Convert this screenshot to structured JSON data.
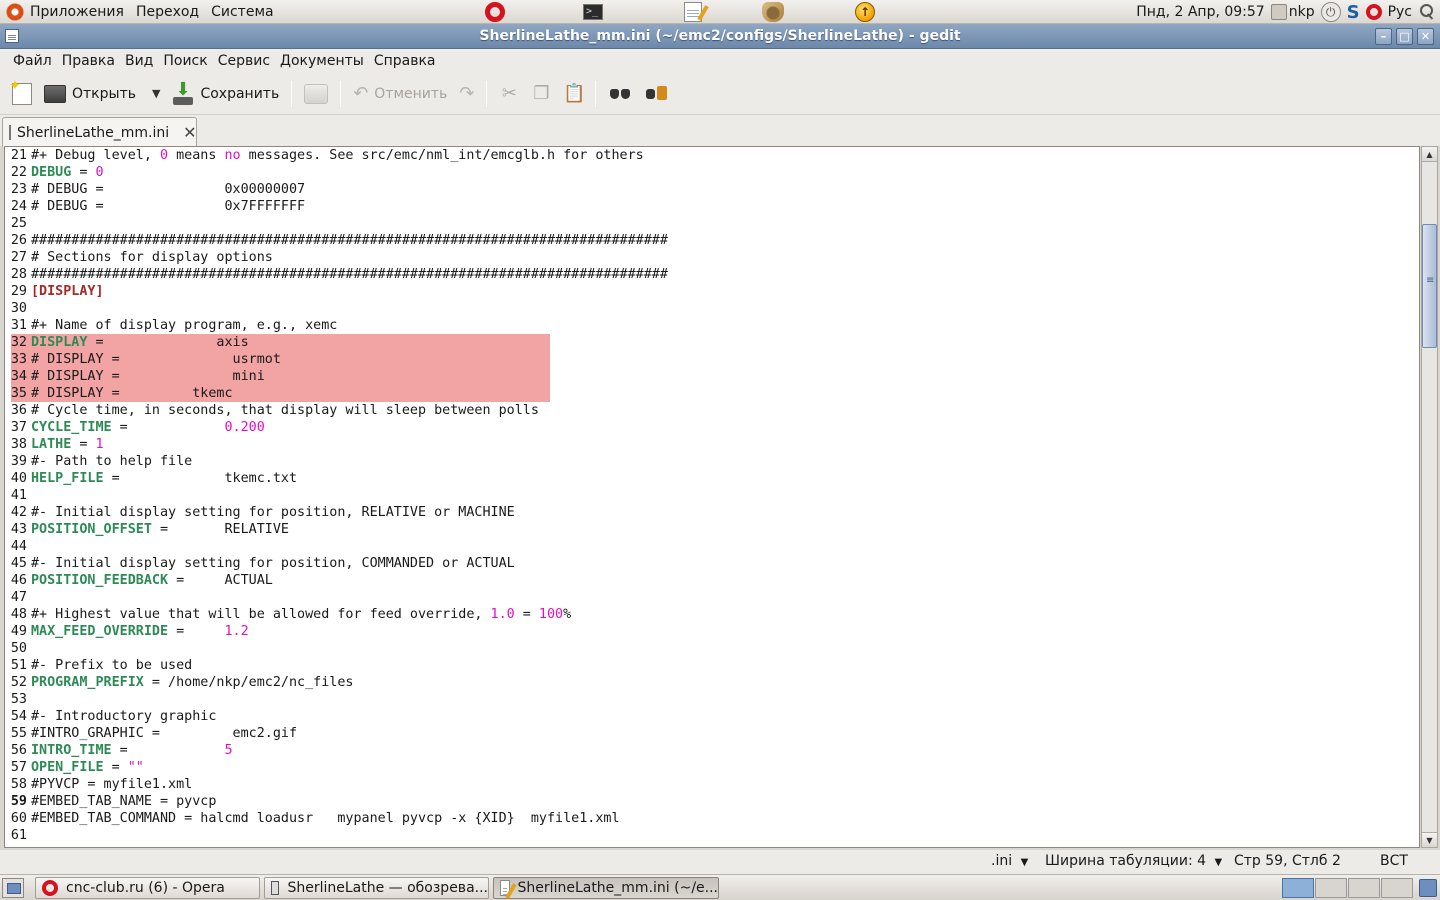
{
  "top_panel": {
    "menus": [
      "Приложения",
      "Переход",
      "Система"
    ],
    "clock": "Пнд,  2 Апр, 09:57",
    "user": "nkp",
    "keyboard_layout": "Рус"
  },
  "window": {
    "title": "SherlineLathe_mm.ini (~/emc2/configs/SherlineLathe) - gedit"
  },
  "menubar": [
    "Файл",
    "Правка",
    "Вид",
    "Поиск",
    "Сервис",
    "Документы",
    "Справка"
  ],
  "toolbar": {
    "open_label": "Открыть",
    "save_label": "Сохранить",
    "undo_label": "Отменить"
  },
  "tab": {
    "label": "SherlineLathe_mm.ini"
  },
  "editor": {
    "current_line": 59,
    "highlight_color": "#f2a3a3",
    "lines": [
      {
        "n": "21",
        "parts": [
          {
            "t": "#+ Debug level, ",
            "c": "txt"
          },
          {
            "t": "0",
            "c": "n"
          },
          {
            "t": " means ",
            "c": "txt"
          },
          {
            "t": "no",
            "c": "n"
          },
          {
            "t": " messages. See src/emc/nml_int/emcglb.h for others",
            "c": "txt"
          }
        ]
      },
      {
        "n": "22",
        "parts": [
          {
            "t": "DEBUG",
            "c": "k"
          },
          {
            "t": " = ",
            "c": "txt"
          },
          {
            "t": "0",
            "c": "n"
          }
        ]
      },
      {
        "n": "23",
        "parts": [
          {
            "t": "# DEBUG =               0x00000007",
            "c": "txt"
          }
        ]
      },
      {
        "n": "24",
        "parts": [
          {
            "t": "# DEBUG =               0x7FFFFFFF",
            "c": "txt"
          }
        ]
      },
      {
        "n": "25",
        "parts": []
      },
      {
        "n": "26",
        "parts": [
          {
            "t": "###############################################################################",
            "c": "txt"
          }
        ]
      },
      {
        "n": "27",
        "parts": [
          {
            "t": "# Sections for display options",
            "c": "txt"
          }
        ]
      },
      {
        "n": "28",
        "parts": [
          {
            "t": "###############################################################################",
            "c": "txt"
          }
        ]
      },
      {
        "n": "29",
        "parts": [
          {
            "t": "[DISPLAY]",
            "c": "sec"
          }
        ]
      },
      {
        "n": "30",
        "parts": []
      },
      {
        "n": "31",
        "parts": [
          {
            "t": "#+ Name of display program, e.g., xemc",
            "c": "txt"
          }
        ]
      },
      {
        "n": "32",
        "parts": [
          {
            "t": "DISPLAY",
            "c": "k"
          },
          {
            "t": " =              axis",
            "c": "txt"
          }
        ]
      },
      {
        "n": "33",
        "parts": [
          {
            "t": "# DISPLAY =              usrmot",
            "c": "txt"
          }
        ]
      },
      {
        "n": "34",
        "parts": [
          {
            "t": "# DISPLAY =              mini",
            "c": "txt"
          }
        ]
      },
      {
        "n": "35",
        "parts": [
          {
            "t": "# DISPLAY =         tkemc",
            "c": "txt"
          }
        ]
      },
      {
        "n": "36",
        "parts": [
          {
            "t": "# Cycle time, in seconds, that display will sleep between polls",
            "c": "txt"
          }
        ]
      },
      {
        "n": "37",
        "parts": [
          {
            "t": "CYCLE_TIME",
            "c": "k"
          },
          {
            "t": " =            ",
            "c": "txt"
          },
          {
            "t": "0.200",
            "c": "n"
          }
        ]
      },
      {
        "n": "38",
        "parts": [
          {
            "t": "LATHE",
            "c": "k"
          },
          {
            "t": " = ",
            "c": "txt"
          },
          {
            "t": "1",
            "c": "n"
          }
        ]
      },
      {
        "n": "39",
        "parts": [
          {
            "t": "#- Path to help file",
            "c": "txt"
          }
        ]
      },
      {
        "n": "40",
        "parts": [
          {
            "t": "HELP_FILE",
            "c": "k"
          },
          {
            "t": " =             tkemc.txt",
            "c": "txt"
          }
        ]
      },
      {
        "n": "41",
        "parts": []
      },
      {
        "n": "42",
        "parts": [
          {
            "t": "#- Initial display setting for position, RELATIVE or MACHINE",
            "c": "txt"
          }
        ]
      },
      {
        "n": "43",
        "parts": [
          {
            "t": "POSITION_OFFSET",
            "c": "k"
          },
          {
            "t": " =       RELATIVE",
            "c": "txt"
          }
        ]
      },
      {
        "n": "44",
        "parts": []
      },
      {
        "n": "45",
        "parts": [
          {
            "t": "#- Initial display setting for position, COMMANDED or ACTUAL",
            "c": "txt"
          }
        ]
      },
      {
        "n": "46",
        "parts": [
          {
            "t": "POSITION_FEEDBACK",
            "c": "k"
          },
          {
            "t": " =     ACTUAL",
            "c": "txt"
          }
        ]
      },
      {
        "n": "47",
        "parts": []
      },
      {
        "n": "48",
        "parts": [
          {
            "t": "#+ Highest value that will be allowed for feed override, ",
            "c": "txt"
          },
          {
            "t": "1.0",
            "c": "n"
          },
          {
            "t": " = ",
            "c": "txt"
          },
          {
            "t": "100",
            "c": "n"
          },
          {
            "t": "%",
            "c": "txt"
          }
        ]
      },
      {
        "n": "49",
        "parts": [
          {
            "t": "MAX_FEED_OVERRIDE",
            "c": "k"
          },
          {
            "t": " =     ",
            "c": "txt"
          },
          {
            "t": "1.2",
            "c": "n"
          }
        ]
      },
      {
        "n": "50",
        "parts": []
      },
      {
        "n": "51",
        "parts": [
          {
            "t": "#- Prefix to be used",
            "c": "txt"
          }
        ]
      },
      {
        "n": "52",
        "parts": [
          {
            "t": "PROGRAM_PREFIX",
            "c": "k"
          },
          {
            "t": " = /home/nkp/emc2/nc_files",
            "c": "txt"
          }
        ]
      },
      {
        "n": "53",
        "parts": []
      },
      {
        "n": "54",
        "parts": [
          {
            "t": "#- Introductory graphic",
            "c": "txt"
          }
        ]
      },
      {
        "n": "55",
        "parts": [
          {
            "t": "#INTRO_GRAPHIC =         emc2.gif",
            "c": "txt"
          }
        ]
      },
      {
        "n": "56",
        "parts": [
          {
            "t": "INTRO_TIME",
            "c": "k"
          },
          {
            "t": " =            ",
            "c": "txt"
          },
          {
            "t": "5",
            "c": "n"
          }
        ]
      },
      {
        "n": "57",
        "parts": [
          {
            "t": "OPEN_FILE",
            "c": "k"
          },
          {
            "t": " = ",
            "c": "txt"
          },
          {
            "t": "\"\"",
            "c": "n"
          }
        ]
      },
      {
        "n": "58",
        "parts": [
          {
            "t": "#PYVCP = myfile1.xml",
            "c": "txt"
          }
        ]
      },
      {
        "n": "59",
        "parts": [
          {
            "t": "#EMBED_TAB_NAME = pyvcp",
            "c": "txt"
          }
        ]
      },
      {
        "n": "60",
        "parts": [
          {
            "t": "#EMBED_TAB_COMMAND = halcmd loadusr   mypanel pyvcp -x {XID}  myfile1.xml",
            "c": "txt"
          }
        ]
      },
      {
        "n": "61",
        "parts": []
      }
    ]
  },
  "statusbar": {
    "language": ".ini",
    "tab_width": "Ширина табуляции: 4",
    "cursor_pos": "Стр 59, Стлб 2",
    "insert_mode": "ВСТ"
  },
  "taskbar": {
    "tasks": [
      {
        "label": "cnc-club.ru (6) - Opera",
        "icon": "opera-icon"
      },
      {
        "label": "SherlineLathe — обозрева...",
        "icon": "file-manager-icon"
      },
      {
        "label": "SherlineLathe_mm.ini (~/e...",
        "icon": "gedit-icon"
      }
    ]
  }
}
